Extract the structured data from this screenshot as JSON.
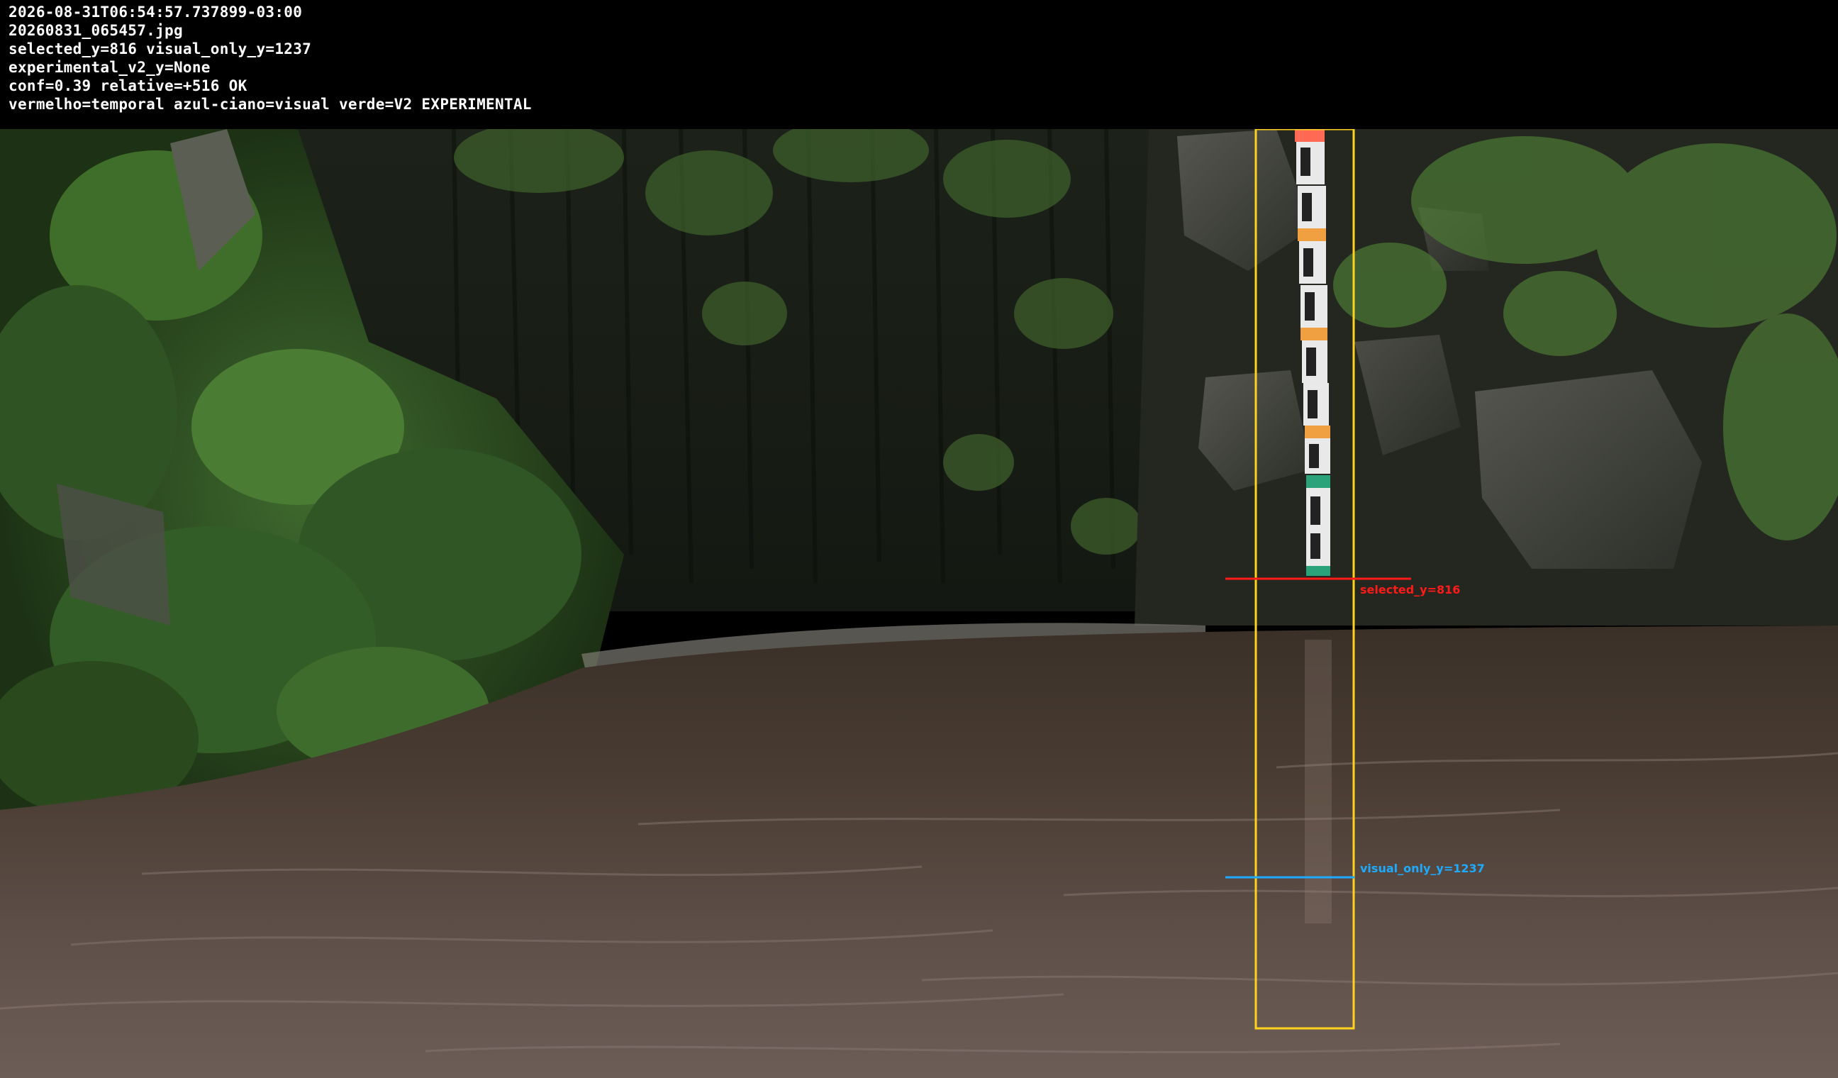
{
  "overlay": {
    "timestamp": "2026-08-31T06:54:57.737899-03:00",
    "filename": "20260831_065457.jpg",
    "selected_line": "selected_y=816  visual_only_y=1237",
    "experimental_line": "experimental_v2_y=None",
    "conf_line": "conf=0.39  relative=+516  OK",
    "legend_line": "vermelho=temporal  azul-ciano=visual  verde=V2 EXPERIMENTAL"
  },
  "annotations": {
    "selected_label": "selected_y=816",
    "visual_label": "visual_only_y=1237"
  },
  "colors": {
    "roi_box": "#ffd21e",
    "temporal_line": "#ff1a1a",
    "visual_line": "#1eaaff",
    "header_bg": "#000000",
    "header_text": "#ffffff"
  },
  "icons": {
    "gauge": "staff-gauge-icon"
  }
}
